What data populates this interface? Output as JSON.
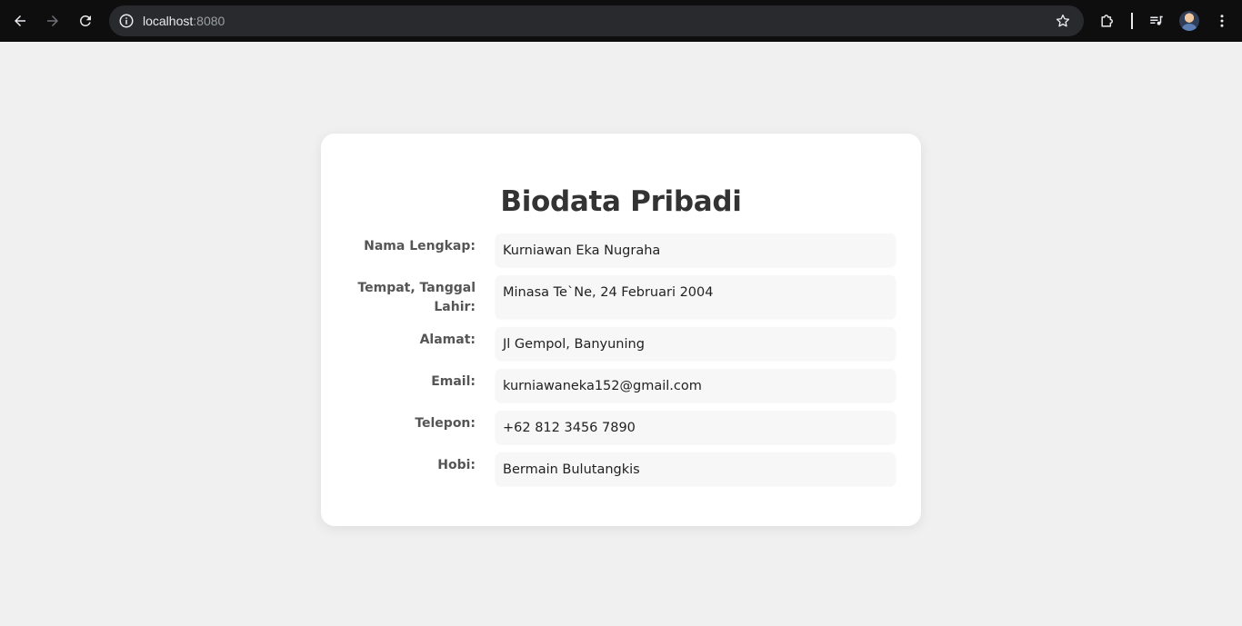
{
  "browser": {
    "url_host": "localhost",
    "url_port": ":8080"
  },
  "page": {
    "title": "Biodata Pribadi",
    "fields": [
      {
        "label": "Nama Lengkap:",
        "value": "Kurniawan Eka Nugraha"
      },
      {
        "label": "Tempat, Tanggal Lahir:",
        "value": "Minasa Te`Ne, 24 Februari 2004"
      },
      {
        "label": "Alamat:",
        "value": "Jl Gempol, Banyuning"
      },
      {
        "label": "Email:",
        "value": "kurniawaneka152@gmail.com"
      },
      {
        "label": "Telepon:",
        "value": "+62 812 3456 7890"
      },
      {
        "label": "Hobi:",
        "value": "Bermain Bulutangkis"
      }
    ]
  },
  "icons": {
    "back": "arrow-left-icon",
    "forward": "arrow-right-icon",
    "reload": "reload-icon",
    "site_info": "info-icon",
    "bookmark": "star-icon",
    "extensions": "puzzle-icon",
    "media": "media-queue-icon",
    "menu": "kebab-menu-icon"
  },
  "colors": {
    "chrome_bg": "#0e0e0f",
    "omnibox_bg": "#282a2d",
    "page_bg": "#f0f0f0",
    "card_bg": "#ffffff",
    "field_bg": "#f7f7f7",
    "title_text": "#333333",
    "label_text": "#555555"
  }
}
